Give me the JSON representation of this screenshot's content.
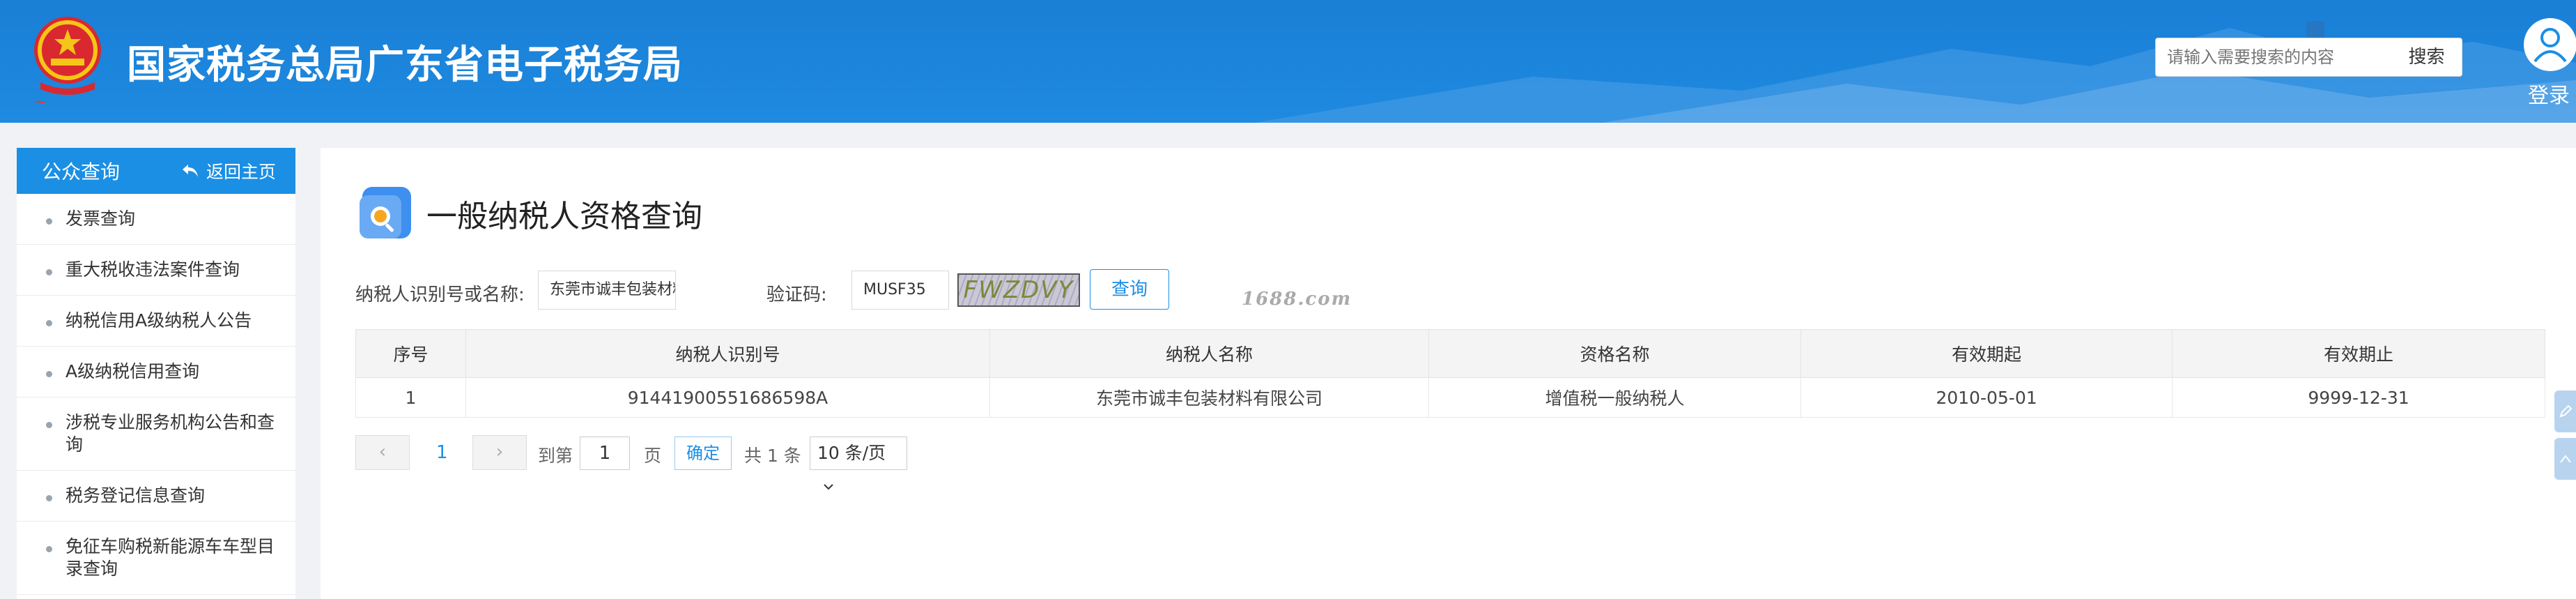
{
  "header": {
    "site_title": "国家税务总局广东省电子税务局",
    "search_placeholder": "请输入需要搜索的内容",
    "search_button": "搜索",
    "login_label": "登录"
  },
  "sidebar": {
    "title": "公众查询",
    "back_home": "返回主页",
    "items": [
      {
        "label": "发票查询"
      },
      {
        "label": "重大税收违法案件查询"
      },
      {
        "label": "纳税信用A级纳税人公告"
      },
      {
        "label": "A级纳税信用查询"
      },
      {
        "label": "涉税专业服务机构公告和查询"
      },
      {
        "label": "税务登记信息查询"
      },
      {
        "label": "免征车购税新能源车车型目录查询"
      }
    ]
  },
  "main": {
    "title": "一般纳税人资格查询",
    "taxpayer_label": "纳税人识别号或名称:",
    "taxpayer_value": "东莞市诚丰包装材料有限公司",
    "captcha_label": "验证码:",
    "captcha_value": "MUSF35",
    "captcha_image_text": "FWZDVY",
    "query_button": "查询",
    "watermark": "1688.com",
    "table": {
      "headers": [
        "序号",
        "纳税人识别号",
        "纳税人名称",
        "资格名称",
        "有效期起",
        "有效期止"
      ],
      "rows": [
        [
          "1",
          "91441900551686598A",
          "东莞市诚丰包装材料有限公司",
          "增值税一般纳税人",
          "2010-05-01",
          "9999-12-31"
        ]
      ]
    },
    "pager": {
      "prev": "‹",
      "current_page": "1",
      "next": "›",
      "goto_prefix": "到第",
      "goto_value": "1",
      "goto_suffix": "页",
      "confirm": "确定",
      "total": "共 1 条",
      "page_size": "10 条/页"
    }
  },
  "colors": {
    "header_blue": "#1a7fd6",
    "accent_blue": "#1b8fe4",
    "background": "#f0f2f5"
  }
}
